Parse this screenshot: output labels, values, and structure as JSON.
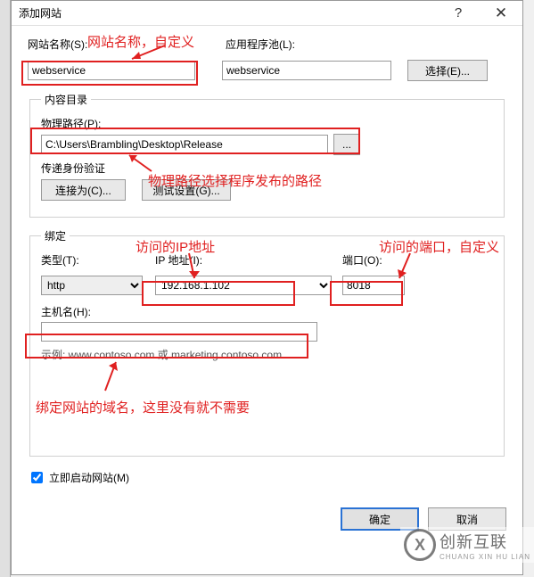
{
  "titlebar": {
    "title": "添加网站",
    "help": "?",
    "close": "✕"
  },
  "site_name": {
    "label": "网站名称(S):",
    "value": "webservice"
  },
  "app_pool": {
    "label": "应用程序池(L):",
    "value": "webservice",
    "select_button": "选择(E)..."
  },
  "content": {
    "legend": "内容目录",
    "path_label": "物理路径(P):",
    "path_value": "C:\\Users\\Brambling\\Desktop\\Release",
    "browse": "...",
    "auth_label": "传递身份验证",
    "connect_as": "连接为(C)...",
    "test_settings": "测试设置(G)..."
  },
  "binding": {
    "legend": "绑定",
    "type_label": "类型(T):",
    "type_value": "http",
    "ip_label": "IP 地址(I):",
    "ip_value": "192.168.1.102",
    "port_label": "端口(O):",
    "port_value": "8018",
    "hostname_label": "主机名(H):",
    "hostname_value": "",
    "example": "示例: www.contoso.com 或 marketing.contoso.com"
  },
  "start_immediately": "立即启动网站(M)",
  "buttons": {
    "ok": "确定",
    "cancel": "取消"
  },
  "annotations": {
    "site_name": "网站名称，自定义",
    "physical_path": "物理路径选择程序发布的路径",
    "ip": "访问的IP地址",
    "port": "访问的端口，自定义",
    "hostname": "绑定网站的域名，这里没有就不需要"
  },
  "watermark": {
    "cn": "创新互联",
    "en": "CHUANG XIN HU LIAN",
    "logo": "X"
  }
}
